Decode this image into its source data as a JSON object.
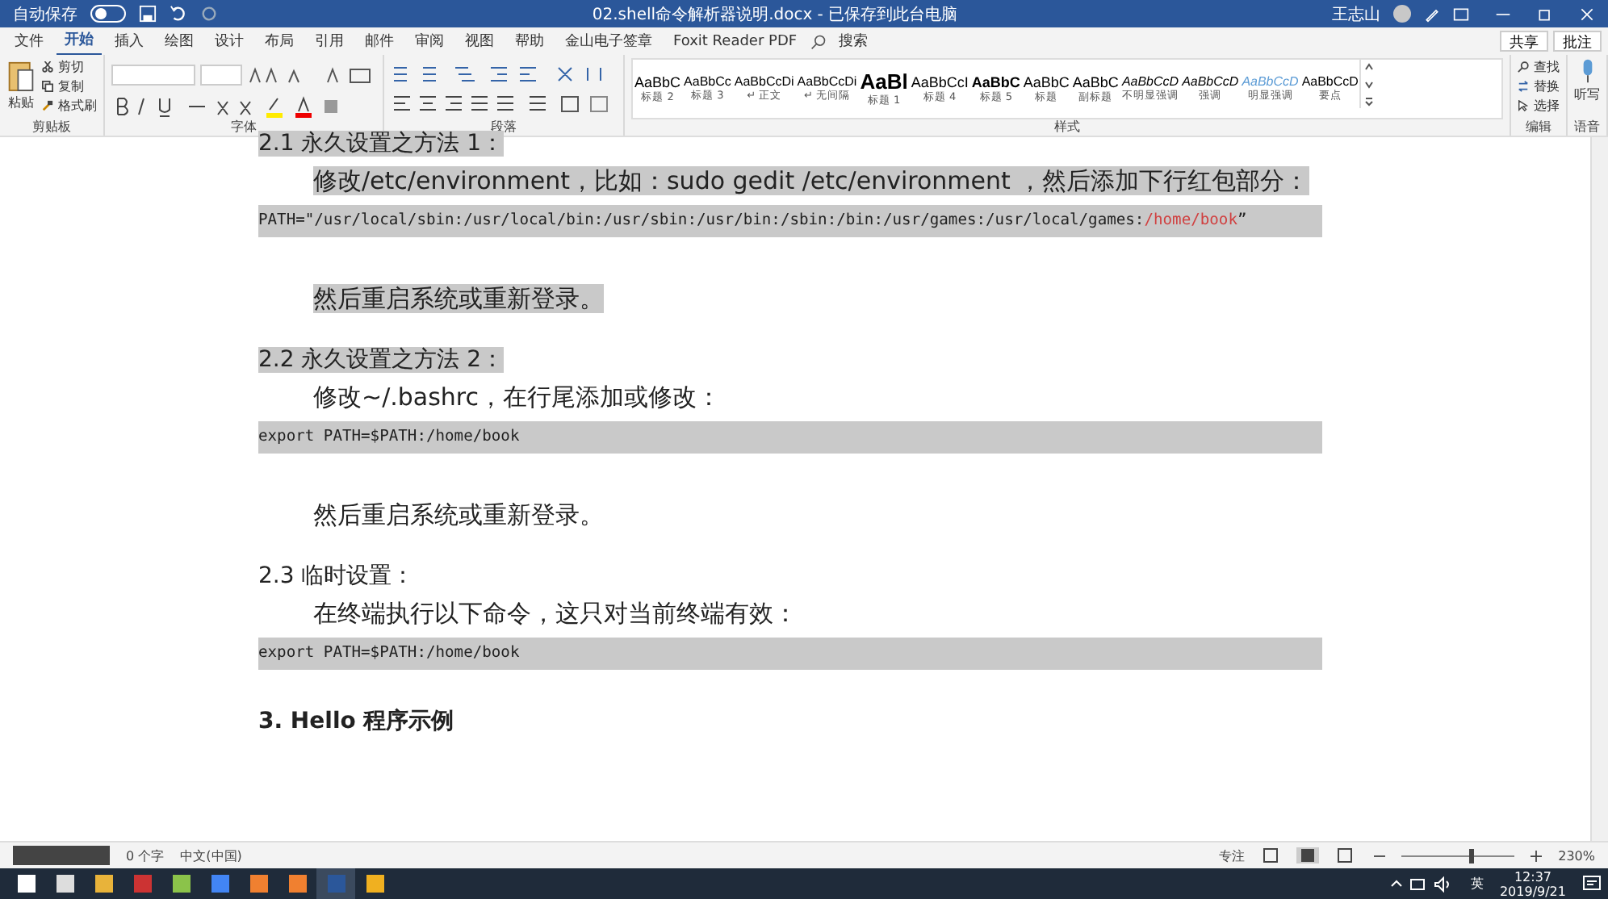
{
  "title_bar": {
    "autosave_label": "自动保存",
    "autosave_on": false,
    "document_title": "02.shell命令解析器说明.docx - 已保存到此台电脑",
    "user_name": "王志山"
  },
  "ribbon_tabs": [
    {
      "label": "文件",
      "selected": false
    },
    {
      "label": "开始",
      "selected": true
    },
    {
      "label": "插入",
      "selected": false
    },
    {
      "label": "绘图",
      "selected": false
    },
    {
      "label": "设计",
      "selected": false
    },
    {
      "label": "布局",
      "selected": false
    },
    {
      "label": "引用",
      "selected": false
    },
    {
      "label": "邮件",
      "selected": false
    },
    {
      "label": "审阅",
      "selected": false
    },
    {
      "label": "视图",
      "selected": false
    },
    {
      "label": "帮助",
      "selected": false
    },
    {
      "label": "金山电子签章",
      "selected": false
    },
    {
      "label": "Foxit Reader PDF",
      "selected": false
    }
  ],
  "search_label": "搜索",
  "share_label": "共享",
  "comments_label": "批注",
  "clipboard": {
    "paste": "粘贴",
    "cut": "剪切",
    "copy": "复制",
    "format_painter": "格式刷",
    "group": "剪贴板"
  },
  "font_group": "字体",
  "paragraph_group": "段落",
  "styles": [
    {
      "preview": "AaBbC",
      "name": "标题 2"
    },
    {
      "preview": "AaBbCc",
      "name": "标题 3"
    },
    {
      "preview": "AaBbCcDi",
      "name": "↵ 正文"
    },
    {
      "preview": "AaBbCcDi",
      "name": "↵ 无间隔"
    },
    {
      "preview": "AaBl",
      "name": "标题 1"
    },
    {
      "preview": "AaBbCcI",
      "name": "标题 4"
    },
    {
      "preview": "AaBbC",
      "name": "标题 5"
    },
    {
      "preview": "AaBbC",
      "name": "标题"
    },
    {
      "preview": "AaBbC",
      "name": "副标题"
    },
    {
      "preview": "AaBbCcD",
      "name": "不明显强调"
    },
    {
      "preview": "AaBbCcD",
      "name": "强调"
    },
    {
      "preview": "AaBbCcD",
      "name": "明显强调"
    },
    {
      "preview": "AaBbCcD",
      "name": "要点"
    }
  ],
  "styles_group": "样式",
  "editing": {
    "find": "查找",
    "replace": "替换",
    "select": "选择",
    "group": "编辑"
  },
  "voice": {
    "dictate": "听写",
    "group": "语音"
  },
  "document": [
    {
      "kind": "heading",
      "text": "2.1 永久设置之方法 1：",
      "highlighted": true
    },
    {
      "kind": "body",
      "text": "修改/etc/environment，比如：sudo gedit /etc/environment ，然后添加下行红包部分：",
      "highlighted": true
    },
    {
      "kind": "code",
      "highlighted": true,
      "parts": [
        {
          "kind": "plain",
          "text": "PATH=\"/usr/local/sbin:/usr/local/bin:/usr/sbin:/usr/bin:/sbin:/bin:/usr/games:/usr/local/games:"
        },
        {
          "kind": "added",
          "text": "/home/book"
        },
        {
          "kind": "plain",
          "text": "”"
        }
      ]
    },
    {
      "kind": "body",
      "text": "然后重启系统或重新登录。",
      "highlighted": true
    },
    {
      "kind": "heading",
      "text": "2.2  永久设置之方法 2：",
      "highlighted": true
    },
    {
      "kind": "body",
      "text": "修改~/.bashrc，在行尾添加或修改：",
      "highlighted": false
    },
    {
      "kind": "code",
      "highlighted": true,
      "parts": [
        {
          "kind": "plain",
          "text": "export PATH=$PATH:/home/book"
        }
      ]
    },
    {
      "kind": "body",
      "text": "然后重启系统或重新登录。",
      "highlighted": false
    },
    {
      "kind": "heading",
      "text": "2.3  临时设置：",
      "highlighted": false
    },
    {
      "kind": "body",
      "text": "在终端执行以下命令，这只对当前终端有效：",
      "highlighted": false
    },
    {
      "kind": "code",
      "highlighted": true,
      "parts": [
        {
          "kind": "plain",
          "text": "export PATH=$PATH:/home/book"
        }
      ]
    },
    {
      "kind": "title",
      "text": "3. Hello 程序示例",
      "highlighted": false
    }
  ],
  "status_bar": {
    "word_count": "0 个字",
    "language": "中文(中国)",
    "focus": "专注",
    "zoom": "230%",
    "level": 0.6
  },
  "taskbar": {
    "ime": "英",
    "time": "12:37",
    "date": "2019/9/21"
  }
}
